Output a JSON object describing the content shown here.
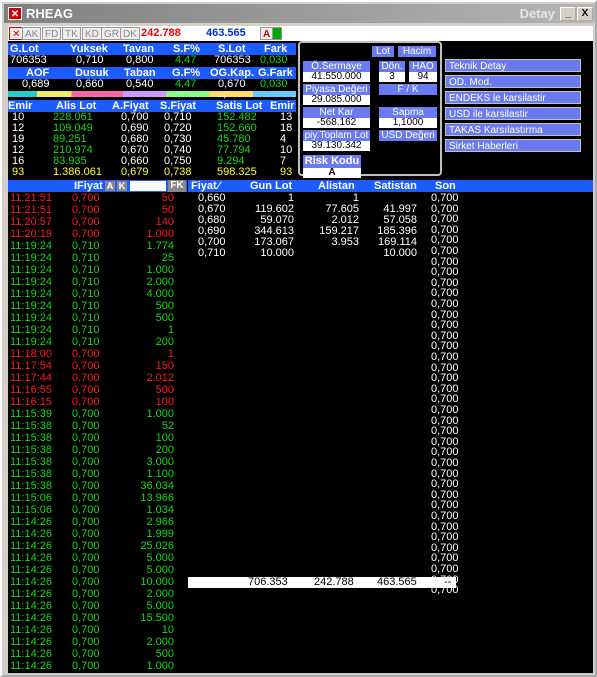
{
  "window": {
    "title": "RHEAG",
    "detay_label": "Detay",
    "minimize_label": "_",
    "maximize_label": "□",
    "close_label": "X"
  },
  "toolbar": {
    "items": [
      "AK",
      "FD",
      "TK",
      "KD",
      "GR",
      "DK"
    ],
    "value1": "242.788",
    "value2": "463.565",
    "a_label": "A"
  },
  "summary": {
    "row1_headers": [
      "G.Lot",
      "Yuksek",
      "Tavan",
      "S.F%",
      "S.Lot",
      "Fark"
    ],
    "row1_values": [
      "706353",
      "0,710",
      "0,800",
      "4,47",
      "706353",
      "0,030"
    ],
    "row2_headers": [
      "AOF",
      "Dusuk",
      "Taban",
      "G.F%",
      "OG.Kap.",
      "G.Fark"
    ],
    "row2_values": [
      "0,689",
      "0,660",
      "0,540",
      "4,47",
      "0,670",
      "0,030"
    ]
  },
  "depth": {
    "headers": [
      "Emir",
      "Alis Lot",
      "A.Fiyat",
      "S.Fiyat",
      "Satis Lot",
      "Emir"
    ],
    "rows": [
      [
        "10",
        "228.061",
        "0,700",
        "0,710",
        "152.482",
        "13"
      ],
      [
        "12",
        "109.049",
        "0,690",
        "0,720",
        "152.660",
        "18"
      ],
      [
        "19",
        "89.251",
        "0,680",
        "0,730",
        "45.780",
        "4"
      ],
      [
        "12",
        "210.974",
        "0,670",
        "0,740",
        "77.794",
        "10"
      ],
      [
        "16",
        "83.935",
        "0,660",
        "0,750",
        "9.294",
        "7"
      ]
    ],
    "total": [
      "93",
      "1.386.061",
      "0,679",
      "0,738",
      "598.325",
      "93"
    ]
  },
  "popup": {
    "lot_label": "Lot",
    "hacim_label": "Hacim",
    "o_sermaye_label": "Ö.Sermaye",
    "o_sermaye_value": "41.550.000",
    "don_label": "Dön.",
    "don_value": "3",
    "hao_label": "HAO",
    "hao_value": "94",
    "piyasa_label": "Piyasa Değeri",
    "piyasa_value": "29.085.000",
    "fk_label": "F / K",
    "net_kar_label": "Net Kar",
    "net_kar_value": "-568.162",
    "sapma_label": "Sapma",
    "sapma_value": "1,1000",
    "piy_toplam_label": "piy.Toplam Lot",
    "piy_toplam_value": "39.130.342",
    "usd_label": "USD Değeri",
    "risk_label": "Risk Kodu",
    "risk_value": "A"
  },
  "side_buttons": [
    "Teknik Detay",
    "OD. Mod.",
    "ENDEKS le karsilastir",
    "USD ile karsilastir",
    "TAKAS Karsılastırma",
    "Sirket Haberleri"
  ],
  "trades": {
    "header_fiyat": "IFiyat",
    "a_btn": "A",
    "k_btn": "K",
    "fk_btn": "FK",
    "rows": [
      {
        "t": "11:21:51",
        "p": "0,700",
        "q": "50",
        "c": "red"
      },
      {
        "t": "11:21:51",
        "p": "0,700",
        "q": "50",
        "c": "red"
      },
      {
        "t": "11:20:57",
        "p": "0,700",
        "q": "140",
        "c": "red"
      },
      {
        "t": "11:20:19",
        "p": "0,700",
        "q": "1.000",
        "c": "red"
      },
      {
        "t": "11:19:24",
        "p": "0,710",
        "q": "1.774",
        "c": "green"
      },
      {
        "t": "11:19:24",
        "p": "0,710",
        "q": "25",
        "c": "green"
      },
      {
        "t": "11:19:24",
        "p": "0,710",
        "q": "1.000",
        "c": "green"
      },
      {
        "t": "11:19:24",
        "p": "0,710",
        "q": "2.000",
        "c": "green"
      },
      {
        "t": "11:19:24",
        "p": "0,710",
        "q": "4.000",
        "c": "green"
      },
      {
        "t": "11:19:24",
        "p": "0,710",
        "q": "500",
        "c": "green"
      },
      {
        "t": "11:19:24",
        "p": "0,710",
        "q": "500",
        "c": "green"
      },
      {
        "t": "11:19:24",
        "p": "0,710",
        "q": "1",
        "c": "green"
      },
      {
        "t": "11:19:24",
        "p": "0,710",
        "q": "200",
        "c": "green"
      },
      {
        "t": "11:18:00",
        "p": "0,700",
        "q": "1",
        "c": "red"
      },
      {
        "t": "11:17:54",
        "p": "0,700",
        "q": "150",
        "c": "red"
      },
      {
        "t": "11:17:44",
        "p": "0,700",
        "q": "2.012",
        "c": "red"
      },
      {
        "t": "11:16:55",
        "p": "0,700",
        "q": "500",
        "c": "red"
      },
      {
        "t": "11:16:15",
        "p": "0,700",
        "q": "100",
        "c": "red"
      },
      {
        "t": "11:15:39",
        "p": "0,700",
        "q": "1.000",
        "c": "green"
      },
      {
        "t": "11:15:38",
        "p": "0,700",
        "q": "52",
        "c": "green"
      },
      {
        "t": "11:15:38",
        "p": "0,700",
        "q": "100",
        "c": "green"
      },
      {
        "t": "11:15:38",
        "p": "0,700",
        "q": "200",
        "c": "green"
      },
      {
        "t": "11:15:38",
        "p": "0,700",
        "q": "3.000",
        "c": "green"
      },
      {
        "t": "11:15:38",
        "p": "0,700",
        "q": "1.100",
        "c": "green"
      },
      {
        "t": "11:15:38",
        "p": "0,700",
        "q": "36.034",
        "c": "green"
      },
      {
        "t": "11:15:06",
        "p": "0,700",
        "q": "13.966",
        "c": "green"
      },
      {
        "t": "11:15:06",
        "p": "0,700",
        "q": "1.034",
        "c": "green"
      },
      {
        "t": "11:14:26",
        "p": "0,700",
        "q": "2.966",
        "c": "green"
      },
      {
        "t": "11:14:26",
        "p": "0,700",
        "q": "1.999",
        "c": "green"
      },
      {
        "t": "11:14:26",
        "p": "0,700",
        "q": "25.026",
        "c": "green"
      },
      {
        "t": "11:14:26",
        "p": "0,700",
        "q": "5.000",
        "c": "green"
      },
      {
        "t": "11:14:26",
        "p": "0,700",
        "q": "5.000",
        "c": "green"
      },
      {
        "t": "11:14:26",
        "p": "0,700",
        "q": "10.000",
        "c": "green"
      },
      {
        "t": "11:14:26",
        "p": "0,700",
        "q": "2.000",
        "c": "green"
      },
      {
        "t": "11:14:26",
        "p": "0,700",
        "q": "5.000",
        "c": "green"
      },
      {
        "t": "11:14:26",
        "p": "0,700",
        "q": "15.500",
        "c": "green"
      },
      {
        "t": "11:14:26",
        "p": "0,700",
        "q": "10",
        "c": "green"
      },
      {
        "t": "11:14:26",
        "p": "0,700",
        "q": "2.000",
        "c": "green"
      },
      {
        "t": "11:14:26",
        "p": "0,700",
        "q": "500",
        "c": "green"
      },
      {
        "t": "11:14:26",
        "p": "0,700",
        "q": "1.000",
        "c": "green"
      }
    ]
  },
  "price_dist": {
    "headers": [
      "Fiyat",
      "Gun Lot",
      "Alistan",
      "Satistan"
    ],
    "rows": [
      [
        "0,660",
        "1",
        "1",
        ""
      ],
      [
        "0,670",
        "119.602",
        "77.605",
        "41.997"
      ],
      [
        "0,680",
        "59.070",
        "2.012",
        "57.058"
      ],
      [
        "0,690",
        "344.613",
        "159.217",
        "185.396"
      ],
      [
        "0,700",
        "173.067",
        "3.953",
        "169.114"
      ],
      [
        "0,710",
        "10.000",
        "",
        "10.000"
      ]
    ],
    "totals": [
      "706.353",
      "242.788",
      "463.565",
      "--"
    ]
  },
  "son_column": {
    "header": "Son",
    "values": [
      "0,700",
      "0,700",
      "0,700",
      "0,700",
      "0,700",
      "0,700",
      "0,700",
      "0,700",
      "0,700",
      "0,700",
      "0,700",
      "0,700",
      "0,700",
      "0,700",
      "0,700",
      "0,700",
      "0,700",
      "0,700",
      "0,700",
      "0,700",
      "0,700",
      "0,700",
      "0,700",
      "0,700",
      "0,700",
      "0,700",
      "0,700",
      "0,700",
      "0,700",
      "0,700",
      "0,700",
      "0,700",
      "0,700",
      "0,700",
      "0,700",
      "0,700",
      "0,700",
      "0,700"
    ]
  }
}
